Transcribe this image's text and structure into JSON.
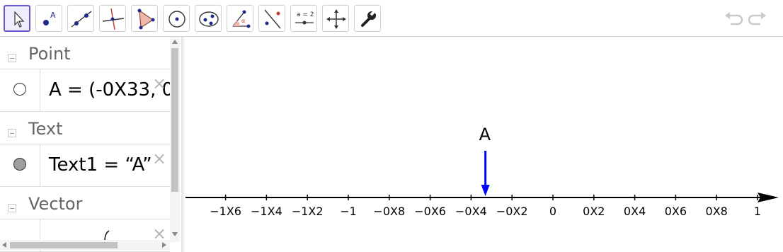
{
  "toolbar": {
    "tools": [
      {
        "name": "move-tool",
        "selected": true
      },
      {
        "name": "point-tool",
        "label": "A"
      },
      {
        "name": "line-tool"
      },
      {
        "name": "perpendicular-line-tool"
      },
      {
        "name": "polygon-tool"
      },
      {
        "name": "circle-center-point-tool"
      },
      {
        "name": "ellipse-tool"
      },
      {
        "name": "angle-tool"
      },
      {
        "name": "reflect-tool"
      },
      {
        "name": "slider-tool",
        "label": "a = 2"
      },
      {
        "name": "move-graphics-view-tool"
      },
      {
        "name": "settings-tool"
      }
    ],
    "accent": "#6557d2"
  },
  "algebra": {
    "groups": [
      {
        "label": "Point",
        "item": {
          "text": "A = (-0X33, 0",
          "marble": "empty"
        }
      },
      {
        "label": "Text",
        "item": {
          "text": "Text1 = “A”",
          "marble": "filled"
        }
      },
      {
        "label": "Vector",
        "item": {
          "text": "",
          "marble": "none"
        }
      }
    ],
    "delete_glyph": "×"
  },
  "graphics": {
    "axis_color": "#000000",
    "vector_color": "#0000ff",
    "point_label": "A",
    "ticks": [
      {
        "value": -1.6,
        "label": "−1X6"
      },
      {
        "value": -1.4,
        "label": "−1X4"
      },
      {
        "value": -1.2,
        "label": "−1X2"
      },
      {
        "value": -1.0,
        "label": "−1"
      },
      {
        "value": -0.8,
        "label": "−0X8"
      },
      {
        "value": -0.6,
        "label": "−0X6"
      },
      {
        "value": -0.4,
        "label": "−0X4"
      },
      {
        "value": -0.2,
        "label": "−0X2"
      },
      {
        "value": 0,
        "label": "0"
      },
      {
        "value": 0.2,
        "label": "0X2"
      },
      {
        "value": 0.4,
        "label": "0X4"
      },
      {
        "value": 0.6,
        "label": "0X6"
      },
      {
        "value": 0.8,
        "label": "0X8"
      },
      {
        "value": 1.0,
        "label": "1"
      }
    ],
    "vector_x": -0.33
  }
}
